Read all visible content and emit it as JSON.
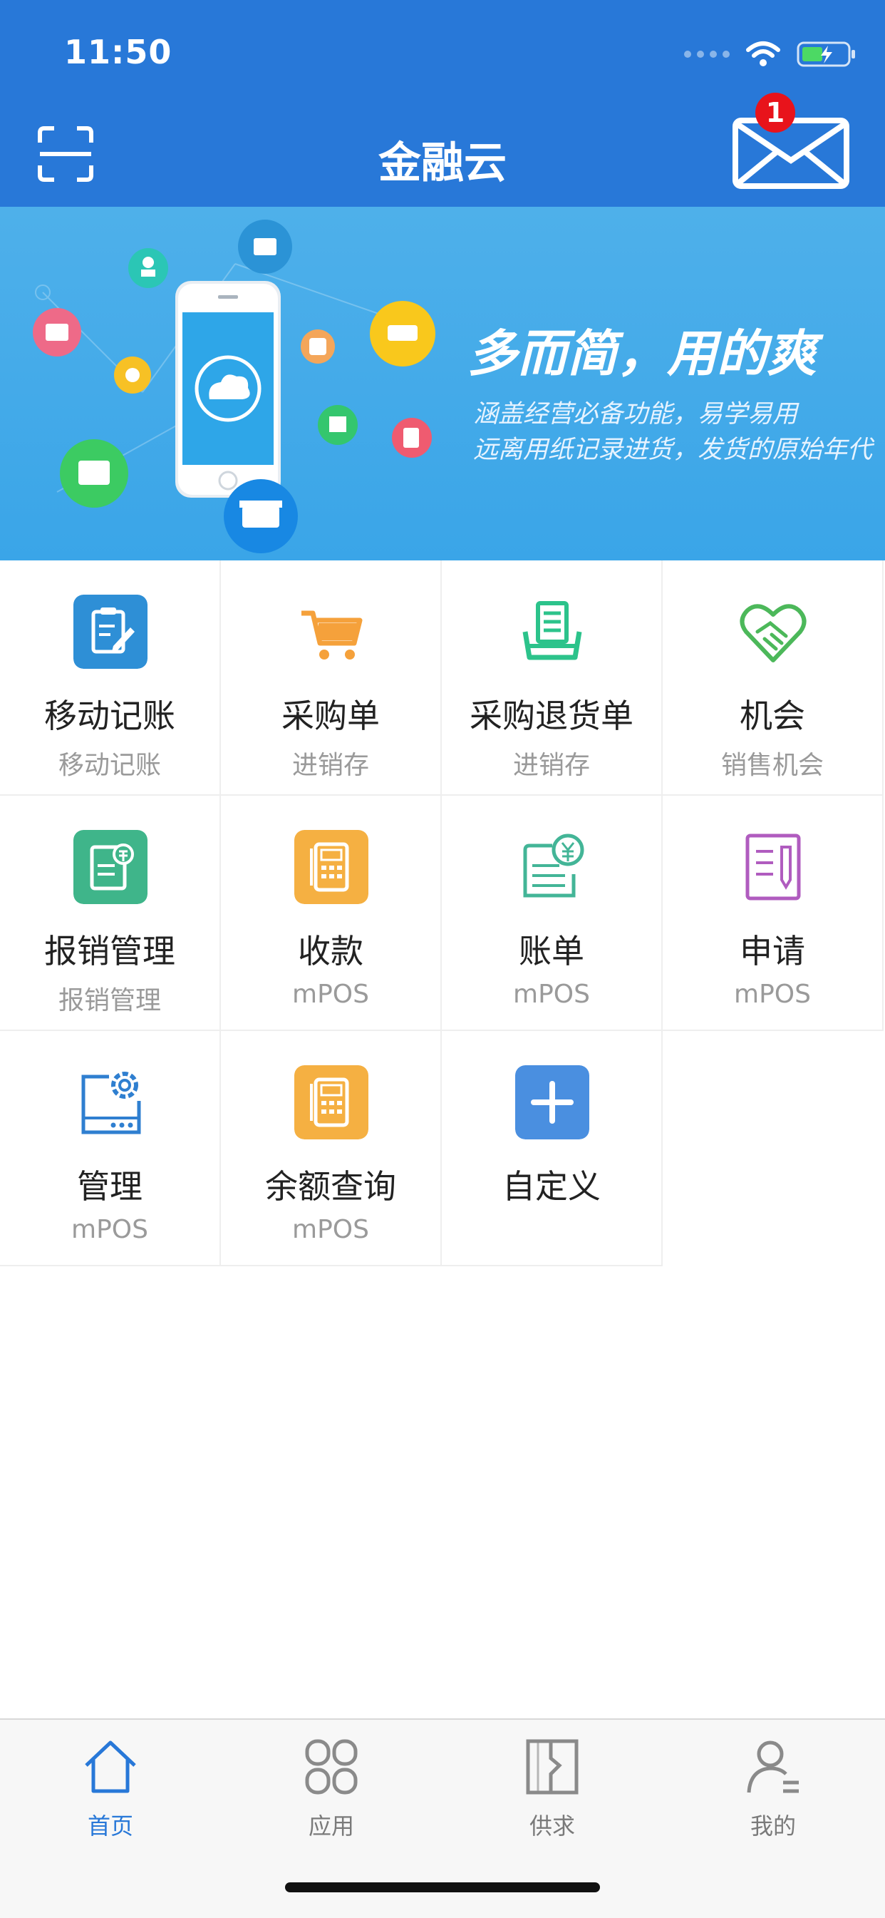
{
  "status_bar": {
    "time": "11:50"
  },
  "nav": {
    "title": "金融云",
    "mail_badge": "1"
  },
  "banner": {
    "headline": "多而简，用的爽",
    "line1": "涵盖经营必备功能，易学易用",
    "line2": "远离用纸记录进货，发货的原始年代"
  },
  "grid": [
    {
      "label": "移动记账",
      "sub": "移动记账",
      "icon": "edit-note-icon",
      "color": "#2e8fd6"
    },
    {
      "label": "采购单",
      "sub": "进销存",
      "icon": "shopping-cart-icon",
      "color": "#f5a13b"
    },
    {
      "label": "采购退货单",
      "sub": "进销存",
      "icon": "return-box-icon",
      "color": "#2cc38b"
    },
    {
      "label": "机会",
      "sub": "销售机会",
      "icon": "handshake-heart-icon",
      "color": "#4cb85a"
    },
    {
      "label": "报销管理",
      "sub": "报销管理",
      "icon": "reimburse-icon",
      "color": "#3fb58a"
    },
    {
      "label": "收款",
      "sub": "mPOS",
      "icon": "pos-terminal-icon",
      "color": "#f5b042"
    },
    {
      "label": "账单",
      "sub": "mPOS",
      "icon": "bill-yen-icon",
      "color": "#43b597"
    },
    {
      "label": "申请",
      "sub": "mPOS",
      "icon": "application-form-icon",
      "color": "#b05cbf"
    },
    {
      "label": "管理",
      "sub": "mPOS",
      "icon": "device-settings-icon",
      "color": "#2f7fd0"
    },
    {
      "label": "余额查询",
      "sub": "mPOS",
      "icon": "pos-terminal-icon",
      "color": "#f5b042"
    },
    {
      "label": "自定义",
      "sub": "",
      "icon": "add-icon",
      "color": "#4a8fe0"
    }
  ],
  "tabbar": [
    {
      "label": "首页",
      "icon": "home-icon",
      "active": true
    },
    {
      "label": "应用",
      "icon": "apps-icon",
      "active": false
    },
    {
      "label": "供求",
      "icon": "supply-demand-icon",
      "active": false
    },
    {
      "label": "我的",
      "icon": "profile-icon",
      "active": false
    }
  ],
  "colors": {
    "primary": "#2878d8",
    "banner": "#3aa5e8",
    "badge": "#e8131b"
  }
}
